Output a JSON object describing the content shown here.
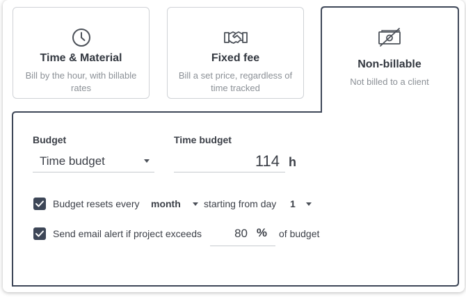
{
  "billing_types": [
    {
      "title": "Time & Material",
      "description": "Bill by the hour, with billable rates",
      "icon": "clock-icon"
    },
    {
      "title": "Fixed fee",
      "description": "Bill a set price, regardless of time tracked",
      "icon": "handshake-icon"
    },
    {
      "title": "Non-billable",
      "description": "Not billed to a client",
      "icon": "no-money-icon",
      "selected": true
    }
  ],
  "budget": {
    "budget_label": "Budget",
    "budget_type_value": "Time budget",
    "time_budget_label": "Time budget",
    "time_budget_value": "114",
    "time_budget_unit": "h"
  },
  "reset": {
    "checked": true,
    "prefix": "Budget resets every",
    "period": "month",
    "middle": "starting from day",
    "day": "1"
  },
  "alert": {
    "checked": true,
    "prefix": "Send email alert if project exceeds",
    "value": "80",
    "unit": "%",
    "suffix": "of budget"
  },
  "colors": {
    "accent": "#3d4657",
    "border": "#cfd2d6",
    "muted_text": "#8b9096"
  }
}
